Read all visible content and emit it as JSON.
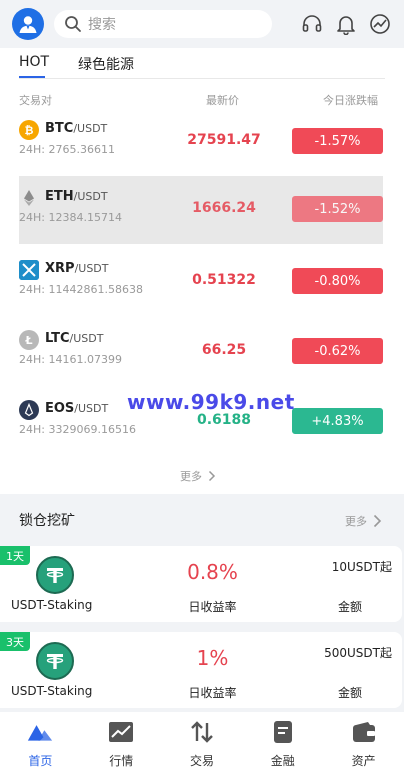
{
  "header": {
    "search_placeholder": "搜索",
    "icons": [
      "avatar-icon",
      "search-icon",
      "headset-icon",
      "bell-icon",
      "chart-globe-icon"
    ]
  },
  "market": {
    "tabs": [
      {
        "label": "HOT",
        "active": true
      },
      {
        "label": "绿色能源",
        "active": false
      }
    ],
    "columns": {
      "pair": "交易对",
      "price": "最新价",
      "change": "今日涨跌幅"
    },
    "rows": [
      {
        "base": "BTC",
        "quote": "/USDT",
        "volume": "24H: 2765.36611",
        "price": "27591.47",
        "change": "-1.57%",
        "direction": "down",
        "icon": "bitcoin-icon",
        "icon_color": "#f7a600"
      },
      {
        "base": "ETH",
        "quote": "/USDT",
        "volume": "24H: 12384.15714",
        "price": "1666.24",
        "change": "-1.52%",
        "direction": "down",
        "icon": "ethereum-icon",
        "icon_color": "#8c8c8c"
      },
      {
        "base": "XRP",
        "quote": "/USDT",
        "volume": "24H: 11442861.58638",
        "price": "0.51322",
        "change": "-0.80%",
        "direction": "down",
        "icon": "xrp-icon",
        "icon_color": "#1e8ec9"
      },
      {
        "base": "LTC",
        "quote": "/USDT",
        "volume": "24H: 14161.07399",
        "price": "66.25",
        "change": "-0.62%",
        "direction": "down",
        "icon": "litecoin-icon",
        "icon_color": "#b8b8b8"
      },
      {
        "base": "EOS",
        "quote": "/USDT",
        "volume": "24H: 3329069.16516",
        "price": "0.6188",
        "change": "+4.83%",
        "direction": "up",
        "icon": "eos-icon",
        "icon_color": "#2d3a55"
      }
    ],
    "more_label": "更多",
    "watermark": "www.99k9.net"
  },
  "staking": {
    "title": "锁仓挖矿",
    "more_label": "更多",
    "items": [
      {
        "days": "1天",
        "name": "USDT-Staking",
        "rate": "0.8%",
        "rate_label": "日收益率",
        "amount": "10USDT起",
        "amount_label": "金额"
      },
      {
        "days": "3天",
        "name": "USDT-Staking",
        "rate": "1%",
        "rate_label": "日收益率",
        "amount": "500USDT起",
        "amount_label": "金额"
      }
    ]
  },
  "nav": [
    {
      "label": "首页",
      "icon": "home-icon",
      "active": true
    },
    {
      "label": "行情",
      "icon": "market-chart-icon",
      "active": false
    },
    {
      "label": "交易",
      "icon": "trade-arrows-icon",
      "active": false
    },
    {
      "label": "金融",
      "icon": "finance-document-icon",
      "active": false
    },
    {
      "label": "资产",
      "icon": "wallet-icon",
      "active": false
    }
  ],
  "colors": {
    "accent": "#2b64e6",
    "down": "#f04a57",
    "up": "#2bb891"
  }
}
